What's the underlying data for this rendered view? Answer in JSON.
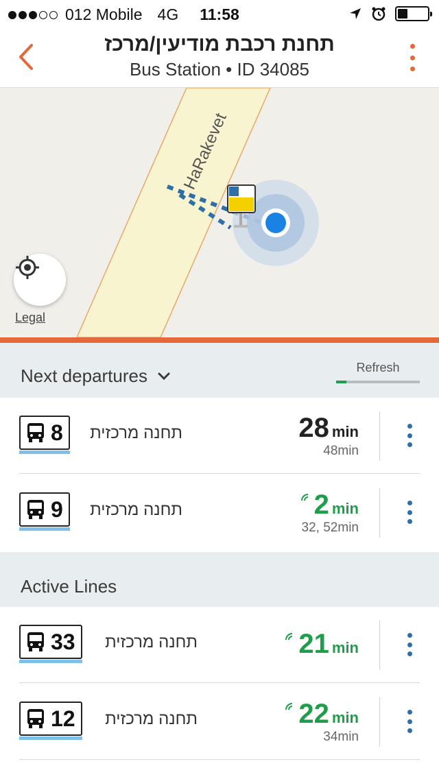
{
  "status_bar": {
    "carrier": "012 Mobile",
    "network": "4G",
    "time": "11:58",
    "signal_bars_filled": 3,
    "signal_bars_total": 5,
    "battery_level": 0.3
  },
  "header": {
    "title": "תחנת רכבת מודיעין/מרכז",
    "subtitle": "Bus Station • ID 34085"
  },
  "map": {
    "street_label": "HaRakevet",
    "legal_label": "Legal"
  },
  "departures": {
    "label": "Next departures",
    "refresh_label": "Refresh",
    "refresh_progress": 0.12,
    "rows": [
      {
        "line": "8",
        "destination": "תחנה מרכזית",
        "eta": "28",
        "unit": "min",
        "later": "48min",
        "realtime": false
      },
      {
        "line": "9",
        "destination": "תחנה מרכזית",
        "eta": "2",
        "unit": "min",
        "later": "32, 52min",
        "realtime": true
      }
    ]
  },
  "active_lines": {
    "label": "Active Lines",
    "rows": [
      {
        "line": "33",
        "destination": "תחנה מרכזית",
        "eta": "21",
        "unit": "min",
        "later": "",
        "realtime": true
      },
      {
        "line": "12",
        "destination": "תחנה מרכזית",
        "eta": "22",
        "unit": "min",
        "later": "34min",
        "realtime": true
      }
    ]
  },
  "colors": {
    "accent_orange": "#e4683a",
    "realtime_green": "#1e9e4a",
    "menu_blue": "#2f6fa8",
    "line_underline": "#7fbfe8",
    "location_blue": "#1a82e2"
  },
  "icons": {
    "back": "chevron-left-icon",
    "more": "more-vertical-icon",
    "locate": "crosshair-icon",
    "bus": "bus-icon",
    "realtime": "realtime-signal-icon",
    "expand": "chevron-down-icon"
  }
}
